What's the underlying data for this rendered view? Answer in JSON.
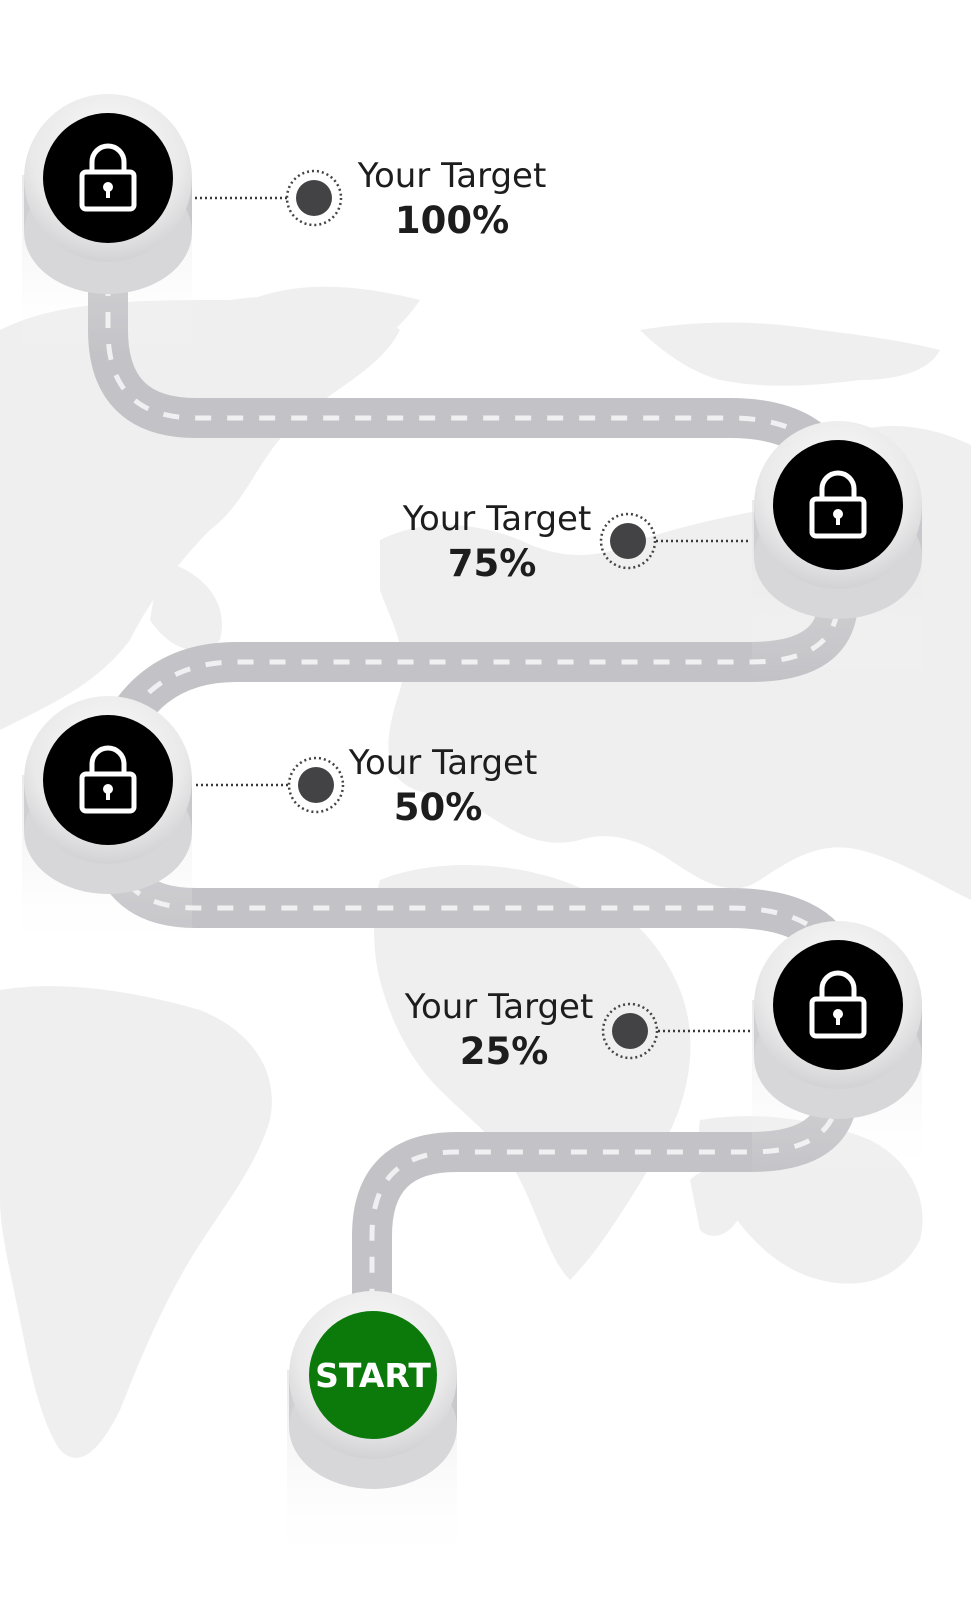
{
  "start_button": {
    "label": "START"
  },
  "milestones": [
    {
      "title": "Your Target",
      "value": "100%",
      "locked": true
    },
    {
      "title": "Your Target",
      "value": "75%",
      "locked": true
    },
    {
      "title": "Your Target",
      "value": "50%",
      "locked": true
    },
    {
      "title": "Your Target",
      "value": "25%",
      "locked": true
    }
  ],
  "colors": {
    "road": "#c3c3c7",
    "road_dash": "#f0f0f2",
    "lock_circle": "#000000",
    "start_circle": "#0b7a0b",
    "dot": "#434345",
    "map": "#efefef"
  }
}
